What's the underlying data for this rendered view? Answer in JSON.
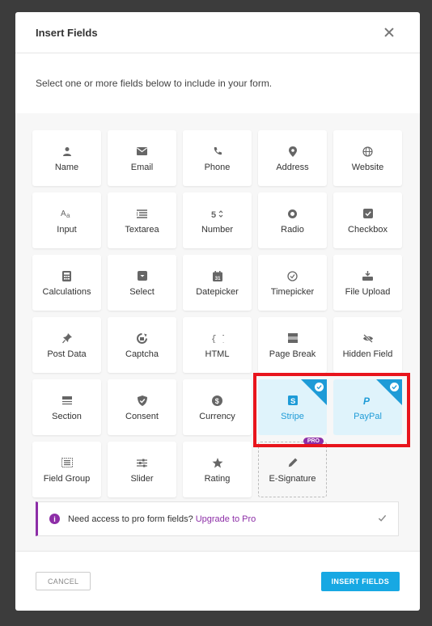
{
  "modal": {
    "title": "Insert Fields",
    "intro": "Select one or more fields below to include in your form."
  },
  "fields": [
    {
      "label": "Name",
      "icon": "user-icon"
    },
    {
      "label": "Email",
      "icon": "envelope-icon"
    },
    {
      "label": "Phone",
      "icon": "phone-icon"
    },
    {
      "label": "Address",
      "icon": "map-pin-icon"
    },
    {
      "label": "Website",
      "icon": "globe-icon"
    },
    {
      "label": "Input",
      "icon": "text-input-icon"
    },
    {
      "label": "Textarea",
      "icon": "textarea-icon"
    },
    {
      "label": "Number",
      "icon": "number-icon"
    },
    {
      "label": "Radio",
      "icon": "radio-icon"
    },
    {
      "label": "Checkbox",
      "icon": "checkbox-icon"
    },
    {
      "label": "Calculations",
      "icon": "calculator-icon"
    },
    {
      "label": "Select",
      "icon": "select-icon"
    },
    {
      "label": "Datepicker",
      "icon": "calendar-icon"
    },
    {
      "label": "Timepicker",
      "icon": "clock-icon"
    },
    {
      "label": "File Upload",
      "icon": "upload-icon"
    },
    {
      "label": "Post Data",
      "icon": "pin-icon"
    },
    {
      "label": "Captcha",
      "icon": "captcha-icon"
    },
    {
      "label": "HTML",
      "icon": "code-icon"
    },
    {
      "label": "Page Break",
      "icon": "page-break-icon"
    },
    {
      "label": "Hidden Field",
      "icon": "eye-slash-icon"
    },
    {
      "label": "Section",
      "icon": "section-icon"
    },
    {
      "label": "Consent",
      "icon": "shield-check-icon"
    },
    {
      "label": "Currency",
      "icon": "dollar-icon"
    },
    {
      "label": "Stripe",
      "icon": "stripe-icon",
      "selected": true
    },
    {
      "label": "PayPal",
      "icon": "paypal-icon",
      "selected": true
    },
    {
      "label": "Field Group",
      "icon": "field-group-icon"
    },
    {
      "label": "Slider",
      "icon": "sliders-icon"
    },
    {
      "label": "Rating",
      "icon": "star-icon"
    },
    {
      "label": "E-Signature",
      "icon": "pen-icon",
      "pro": true,
      "badge": "PRO"
    }
  ],
  "notice": {
    "text": "Need access to pro form fields?",
    "link": "Upgrade to Pro"
  },
  "footer": {
    "cancel": "CANCEL",
    "insert": "INSERT FIELDS"
  },
  "colors": {
    "accent": "#17a8e3",
    "selected_bg": "#dff3fb",
    "pro": "#8d2ea7",
    "highlight": "#e8141c"
  }
}
